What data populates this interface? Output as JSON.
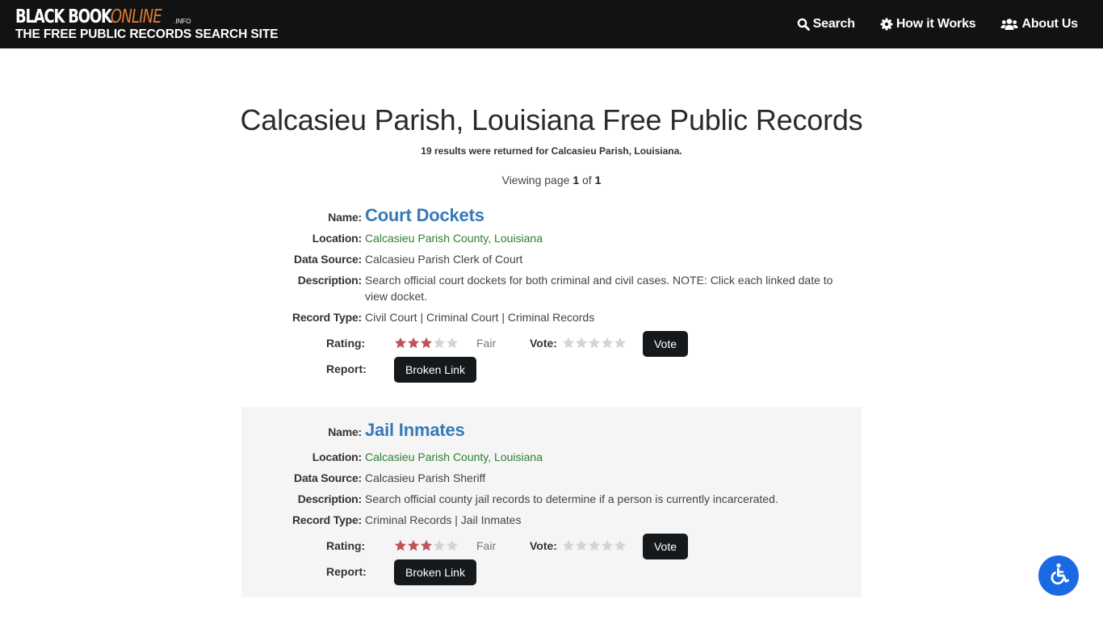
{
  "header": {
    "logo": {
      "word1": "BLACK BOOK",
      "word2": "ONLINE",
      "suffix": ".INFO",
      "tagline": "THE FREE PUBLIC RECORDS SEARCH SITE"
    },
    "nav": [
      {
        "label": "Search",
        "icon": "search-icon"
      },
      {
        "label": "How it Works",
        "icon": "gear-icon"
      },
      {
        "label": "About Us",
        "icon": "users-icon"
      }
    ]
  },
  "page": {
    "title": "Calcasieu Parish, Louisiana Free Public Records",
    "summary": "19 results were returned for Calcasieu Parish, Louisiana.",
    "pager": {
      "prefix": "Viewing page ",
      "current": "1",
      "middle": " of ",
      "total": "1"
    }
  },
  "labels": {
    "name": "Name:",
    "location": "Location:",
    "data_source": "Data Source:",
    "description": "Description:",
    "record_type": "Record Type:",
    "rating": "Rating:",
    "vote": "Vote:",
    "report": "Report:",
    "vote_button": "Vote",
    "broken_link_button": "Broken Link"
  },
  "records": [
    {
      "name": "Court Dockets",
      "location": "Calcasieu Parish County, Louisiana",
      "data_source": "Calcasieu Parish Clerk of Court",
      "description": "Search official court dockets for both criminal and civil cases. NOTE: Click each linked date to view docket.",
      "record_type": "Civil Court | Criminal Court | Criminal Records",
      "rating_stars": 3,
      "rating_max": 5,
      "rating_word": "Fair",
      "vote_stars": 0
    },
    {
      "name": "Jail Inmates",
      "location": "Calcasieu Parish County, Louisiana",
      "data_source": "Calcasieu Parish Sheriff",
      "description": "Search official county jail records to determine if a person is currently incarcerated.",
      "record_type": "Criminal Records | Jail Inmates",
      "rating_stars": 3,
      "rating_max": 5,
      "rating_word": "Fair",
      "vote_stars": 0
    }
  ],
  "colors": {
    "header_bg": "#121212",
    "logo_accent": "#e07a38",
    "name_link": "#3779b7",
    "location_link": "#2f7d32",
    "star_filled": "#c0525a",
    "star_empty": "#d4d4d4",
    "button_bg": "#15191b",
    "accessibility_bg": "#1a6ae4",
    "alt_row_bg": "#f5f5f5"
  },
  "accessibility": {
    "icon": "wheelchair-icon"
  }
}
